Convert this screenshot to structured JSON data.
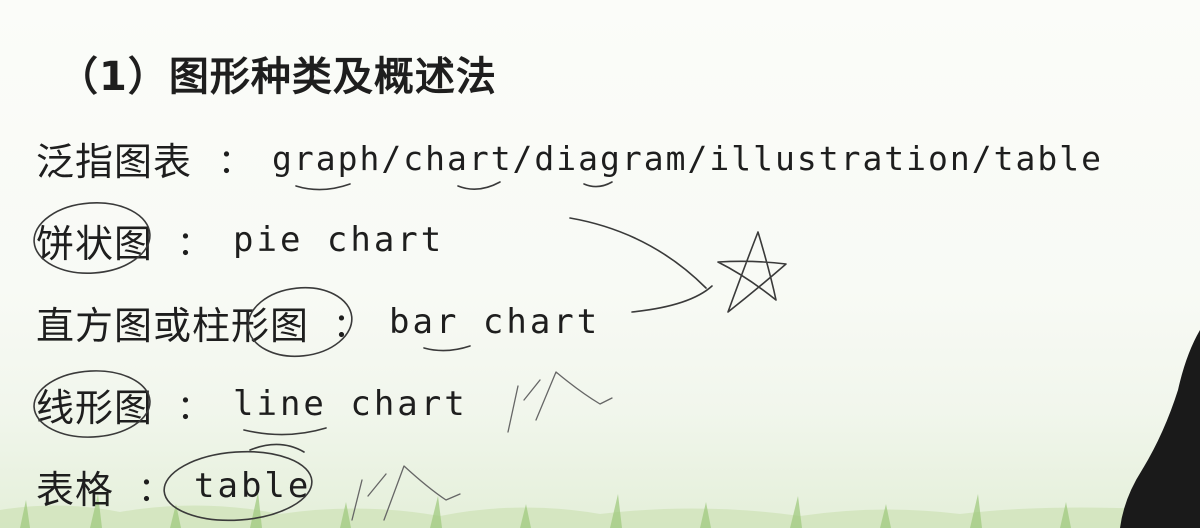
{
  "title": "（1）图形种类及概述法",
  "separator": "：",
  "terms": [
    {
      "cn": "泛指图表",
      "en": "graph/chart/diagram/illustration/table"
    },
    {
      "cn": "饼状图",
      "en": "pie chart"
    },
    {
      "cn": "直方图或柱形图",
      "en": "bar chart"
    },
    {
      "cn": "线形图",
      "en": "line chart"
    },
    {
      "cn": "表格",
      "en": "table"
    }
  ]
}
